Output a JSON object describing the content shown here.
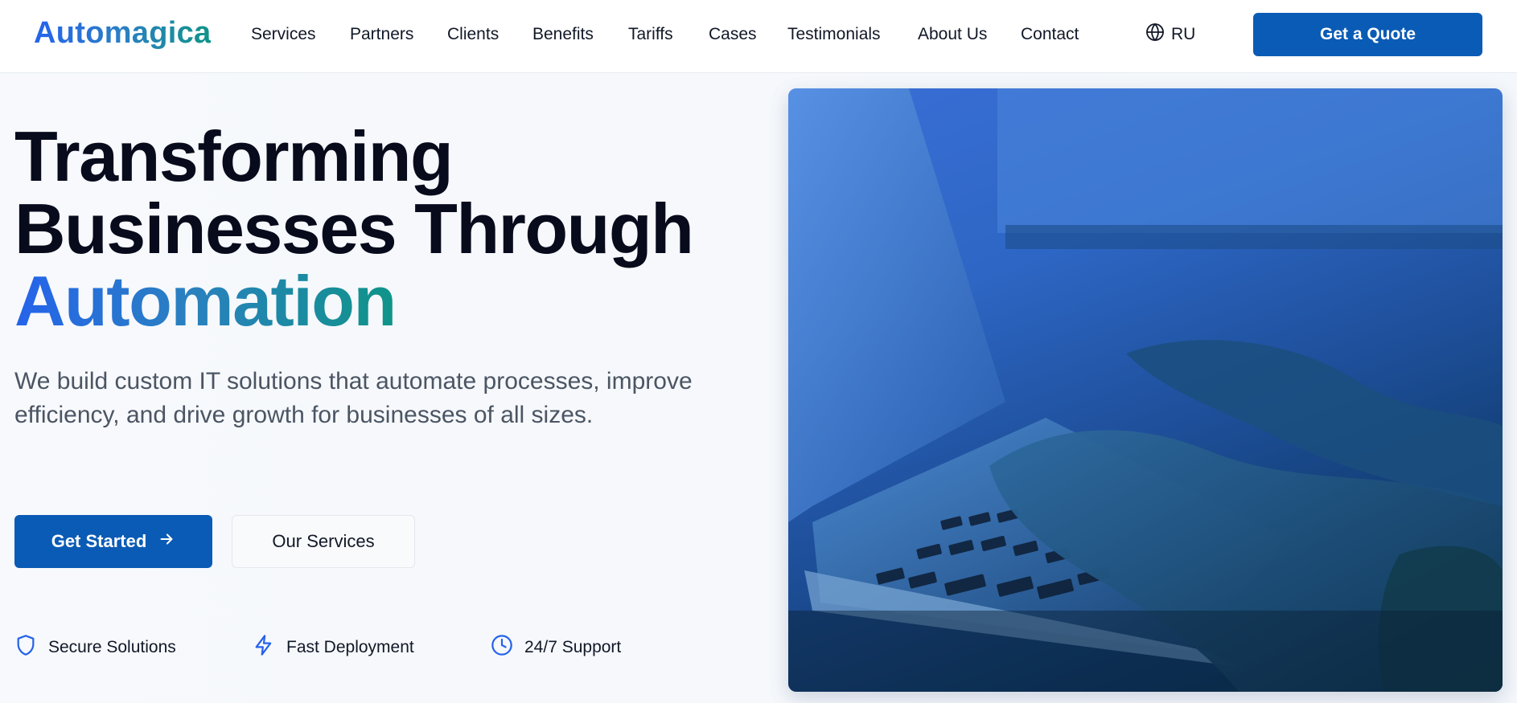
{
  "brand": {
    "logo": "Automagica"
  },
  "nav": {
    "items": [
      {
        "label": "Services"
      },
      {
        "label": "Partners"
      },
      {
        "label": "Clients"
      },
      {
        "label": "Benefits"
      },
      {
        "label": "Tariffs"
      },
      {
        "label": "Cases"
      },
      {
        "label": "Testimonials"
      },
      {
        "label": "About Us"
      },
      {
        "label": "Contact"
      }
    ],
    "language": "RU",
    "language_icon": "globe-icon",
    "quote_label": "Get a Quote"
  },
  "hero": {
    "headline_line1": "Transforming",
    "headline_line2": "Businesses Through",
    "headline_accent": "Automation",
    "subtitle": "We build custom IT solutions that automate processes, improve efficiency, and drive growth for businesses of all sizes.",
    "primary_cta": "Get Started",
    "primary_cta_icon": "arrow-right-icon",
    "secondary_cta": "Our Services",
    "features": [
      {
        "label": "Secure Solutions",
        "icon": "shield-icon"
      },
      {
        "label": "Fast Deployment",
        "icon": "lightning-icon"
      },
      {
        "label": "24/7 Support",
        "icon": "clock-icon"
      }
    ],
    "image_subject": "hands typing on laptop keyboard"
  },
  "colors": {
    "primary": "#0a5bb5",
    "accent_blue": "#2563eb",
    "accent_teal": "#0f9488",
    "text_dark": "#070b1c",
    "text_muted": "#4b5563"
  }
}
